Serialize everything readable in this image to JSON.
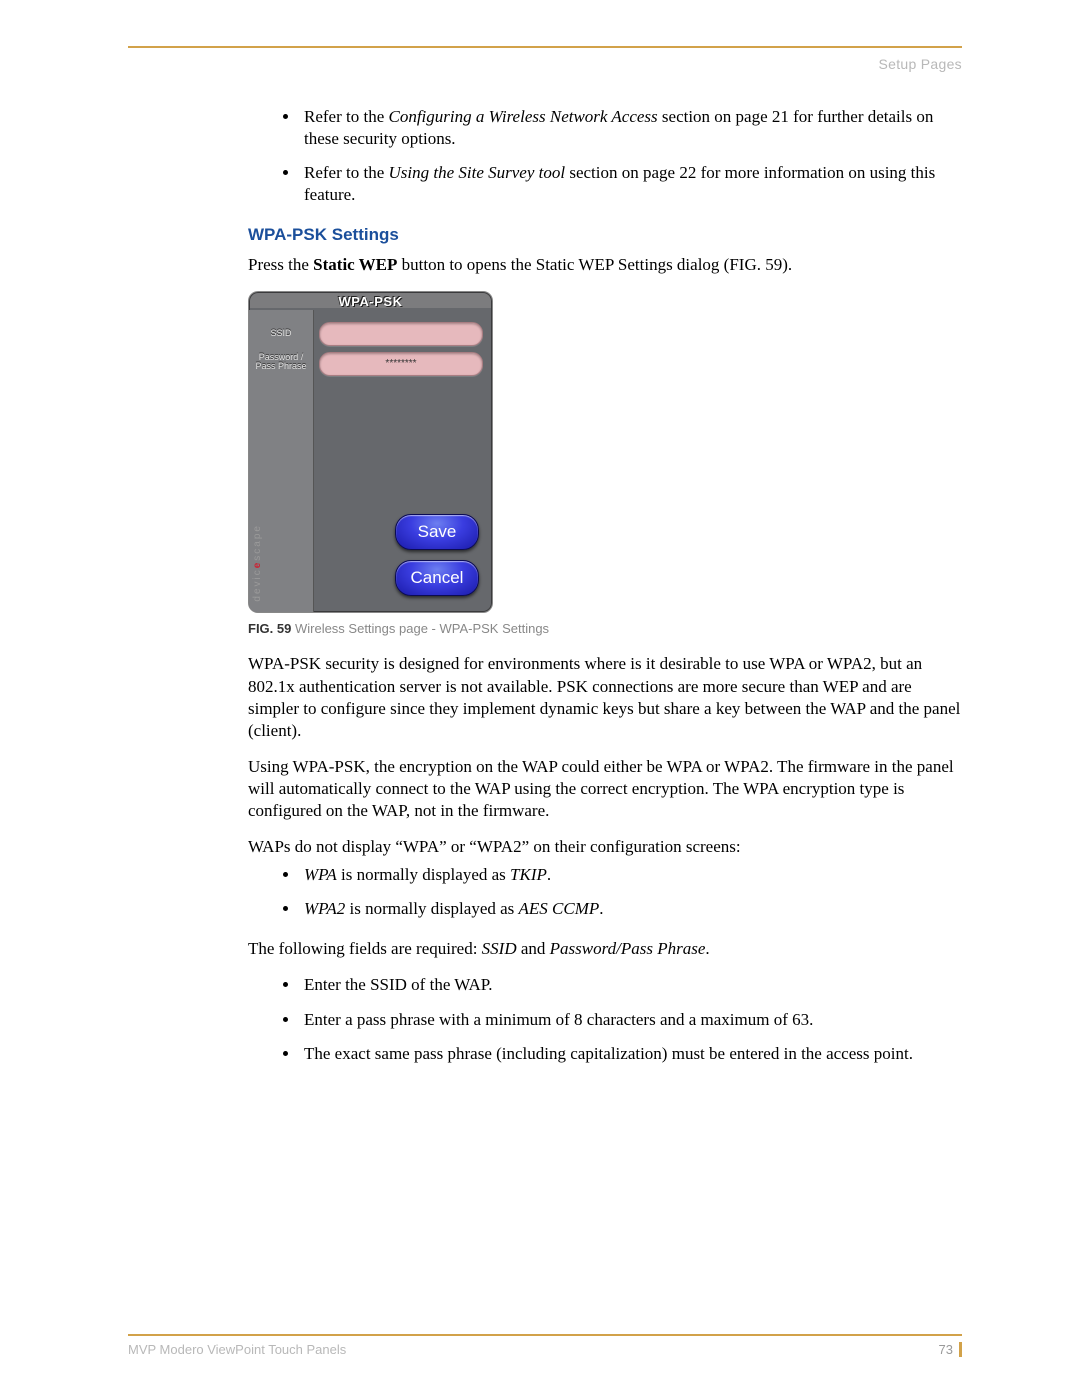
{
  "header": {
    "label": "Setup Pages"
  },
  "intro_bullets": [
    {
      "pre": "Refer to the ",
      "em": "Configuring a Wireless Network Access",
      "post": " section on page 21 for further details on these security options."
    },
    {
      "pre": "Refer to the ",
      "em": "Using the Site Survey tool",
      "post": " section on page 22 for more information on using this feature."
    }
  ],
  "section": {
    "title": "WPA-PSK Settings",
    "opener_pre": "Press the ",
    "opener_bold": "Static WEP",
    "opener_post": " button to opens the Static WEP Settings dialog (FIG. 59)."
  },
  "device": {
    "title": "WPA-PSK",
    "ssid_label": "SSID",
    "pass_label1": "Password /",
    "pass_label2": "Pass Phrase",
    "ssid_value": "",
    "pass_value": "********",
    "save": "Save",
    "cancel": "Cancel",
    "brand_gray": "devic  scap",
    "brand_red": "e",
    "brand_tail": "e"
  },
  "caption": {
    "bold": "FIG. 59",
    "rest": "  Wireless Settings page - WPA-PSK Settings"
  },
  "body": {
    "p1": "WPA-PSK security is designed for environments where is it desirable to use WPA or WPA2, but an 802.1x authentication server is not available. PSK connections are more secure than WEP and are simpler to configure since they implement dynamic keys but share a key between the WAP and the panel (client).",
    "p2": "Using WPA-PSK, the encryption on the WAP could either be WPA or WPA2. The firmware in the panel will automatically connect to the WAP using the correct encryption. The WPA encryption type is configured on the WAP, not in the firmware.",
    "p3": "WAPs do not display “WPA” or “WPA2” on their configuration screens:",
    "wpa_bullets": [
      {
        "em": "WPA",
        "mid": " is normally displayed as ",
        "em2": "TKIP",
        "tail": "."
      },
      {
        "em": "WPA2",
        "mid": " is normally displayed as ",
        "em2": "AES CCMP",
        "tail": "."
      }
    ],
    "p4_pre": "The following fields are required: ",
    "p4_em1": "SSID",
    "p4_mid": " and ",
    "p4_em2": "Password/Pass Phrase",
    "p4_post": ".",
    "req_bullets": [
      "Enter the SSID of the WAP.",
      "Enter a pass phrase with a minimum of 8 characters and a maximum of 63.",
      "The exact same pass phrase (including capitalization) must be entered in the access point."
    ]
  },
  "footer": {
    "left": "MVP Modero ViewPoint Touch Panels",
    "page": "73"
  }
}
